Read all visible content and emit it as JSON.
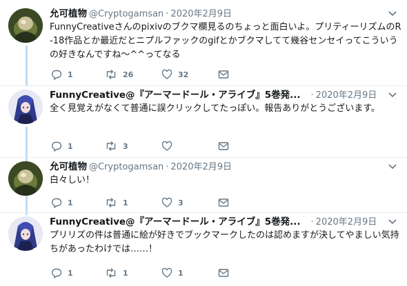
{
  "tweets": [
    {
      "name": "允可植物",
      "handle": "@Cryptogamsan",
      "dot": "·",
      "date": "2020年2月9日",
      "text": "FunnyCreativeさんのpixivのブクマ欄見るのちょっと面白いよ。プリティーリズムのR-18作品とか最近だとニプルファックのgifとかブクマしてて幾谷センセイってこういうの好きなんですね〜^^ってなる",
      "reply_count": "1",
      "retweet_count": "26",
      "like_count": "32",
      "avatar": "avatar-cryptogam"
    },
    {
      "name": "FunnyCreative@『アーマードール・アライブ』5巻発...",
      "handle": "",
      "dot": "·",
      "date": "2020年2月9日",
      "text": "全く見覚えがなくて普通に誤クリックしてたっぽい。報告ありがとうございます。",
      "reply_count": "1",
      "retweet_count": "3",
      "like_count": "",
      "avatar": "avatar-funnycreative"
    },
    {
      "name": "允可植物",
      "handle": "@Cryptogamsan",
      "dot": "·",
      "date": "2020年2月9日",
      "text": "白々しい！",
      "reply_count": "1",
      "retweet_count": "1",
      "like_count": "3",
      "avatar": "avatar-cryptogam"
    },
    {
      "name": "FunnyCreative@『アーマードール・アライブ』5巻発...",
      "handle": "",
      "dot": "·",
      "date": "2020年2月9日",
      "text": "プリリズの件は普通に絵が好きでブックマークしたのは認めますが決してやましい気持ちがあったわけでは……！",
      "reply_count": "1",
      "retweet_count": "1",
      "like_count": "1",
      "avatar": "avatar-funnycreative"
    }
  ],
  "icons": {
    "reply": "reply-icon",
    "retweet": "retweet-icon",
    "like": "heart-icon",
    "message": "envelope-icon",
    "more": "chevron-down-icon"
  },
  "colors": {
    "name": "#14171a",
    "secondary": "#657786",
    "thread_line": "#bcdcf5",
    "divider": "#e6ecf0"
  }
}
